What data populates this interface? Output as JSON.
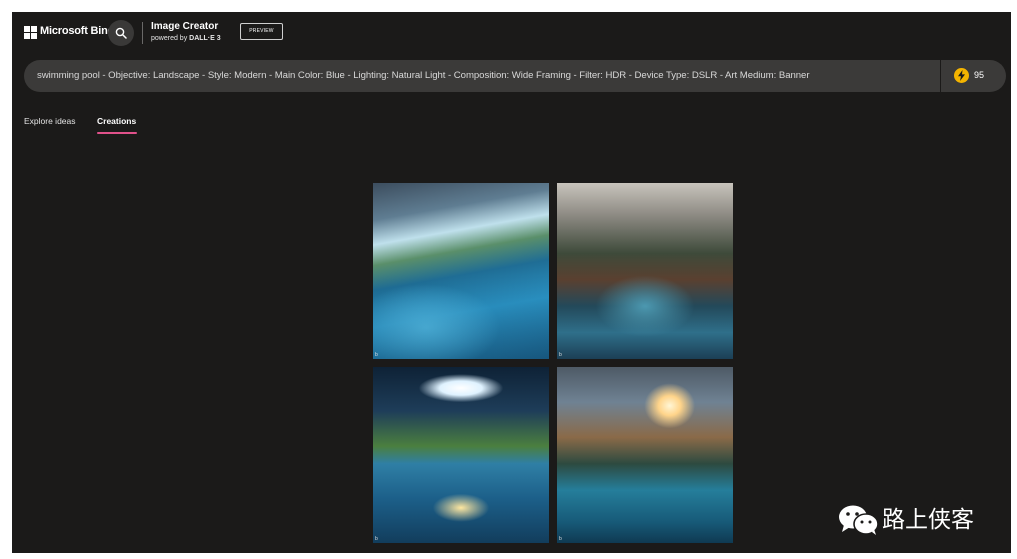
{
  "header": {
    "brand": "Microsoft Bing",
    "title": "Image Creator",
    "subtitle_prefix": "powered by ",
    "subtitle_brand": "DALL·E 3",
    "badge": "PREVIEW"
  },
  "prompt": {
    "text": "swimming pool - Objective: Landscape - Style: Modern - Main Color: Blue - Lighting: Natural Light - Composition: Wide Framing - Filter: HDR - Device Type: DSLR - Art Medium: Banner",
    "boosts": "95"
  },
  "tabs": [
    {
      "label": "Explore ideas",
      "active": false
    },
    {
      "label": "Creations",
      "active": true
    }
  ],
  "images": [
    {
      "icon": "b"
    },
    {
      "icon": "b"
    },
    {
      "icon": "b"
    },
    {
      "icon": "b"
    }
  ],
  "watermark": {
    "text": "路上侠客",
    "icon": "wechat-icon"
  },
  "colors": {
    "background": "#1b1a19",
    "accent": "#e0518a",
    "coin": "#f4b400",
    "prompt_bg": "#3b3a39"
  }
}
